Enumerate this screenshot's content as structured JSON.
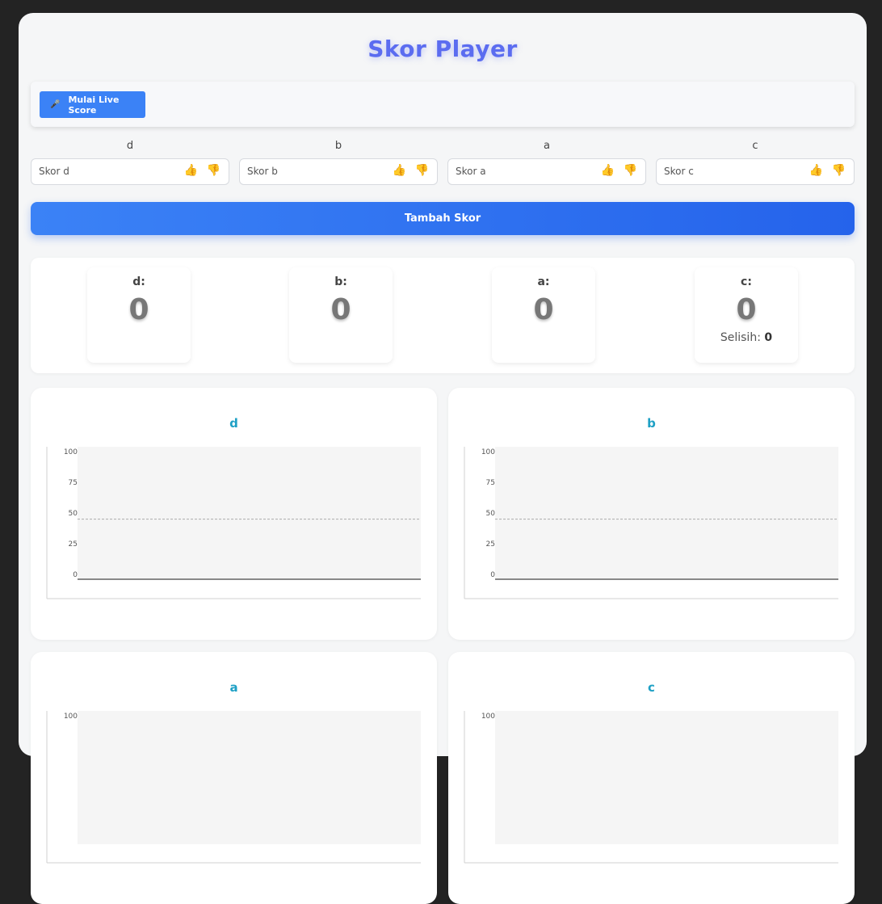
{
  "header": {
    "title": "Skor Player"
  },
  "live": {
    "button_icon": "🎤",
    "button_label": "Mulai Live Score"
  },
  "players": [
    {
      "name": "d",
      "placeholder": "Skor d",
      "score": "0",
      "score_label": "d:"
    },
    {
      "name": "b",
      "placeholder": "Skor b",
      "score": "0",
      "score_label": "b:"
    },
    {
      "name": "a",
      "placeholder": "Skor a",
      "score": "0",
      "score_label": "a:"
    },
    {
      "name": "c",
      "placeholder": "Skor c",
      "score": "0",
      "score_label": "c:"
    }
  ],
  "thumb_up_icon": "👍",
  "thumb_down_icon": "👎",
  "add_button_label": "Tambah Skor",
  "difference": {
    "label": "Selisih:",
    "value": "0"
  },
  "charts": [
    {
      "title": "d",
      "y_ticks": [
        "100",
        "75",
        "50",
        "25",
        "0"
      ]
    },
    {
      "title": "b",
      "y_ticks": [
        "100",
        "75",
        "50",
        "25",
        "0"
      ]
    },
    {
      "title": "a",
      "y_ticks": [
        "100"
      ]
    },
    {
      "title": "c",
      "y_ticks": [
        "100"
      ]
    }
  ],
  "chart_data": [
    {
      "type": "line",
      "title": "d",
      "ylim": [
        0,
        100
      ],
      "yticks": [
        0,
        25,
        50,
        75,
        100
      ],
      "series": [
        {
          "values": [
            0,
            0
          ]
        }
      ],
      "reference_line": 45
    },
    {
      "type": "line",
      "title": "b",
      "ylim": [
        0,
        100
      ],
      "yticks": [
        0,
        25,
        50,
        75,
        100
      ],
      "series": [
        {
          "values": [
            0,
            0
          ]
        }
      ],
      "reference_line": 45
    },
    {
      "type": "line",
      "title": "a",
      "ylim": [
        0,
        100
      ],
      "yticks": [
        100
      ],
      "series": []
    },
    {
      "type": "line",
      "title": "c",
      "ylim": [
        0,
        100
      ],
      "yticks": [
        100
      ],
      "series": []
    }
  ]
}
